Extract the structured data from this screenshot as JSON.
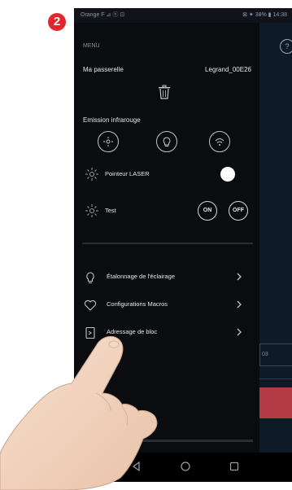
{
  "step_badge": "2",
  "status_bar": {
    "left": "Orange F  ⊿ ⓝ  ⊡",
    "right": "⊠ ⁕ 38% ▮ 14:38"
  },
  "background": {
    "help": "?",
    "input_value": "03"
  },
  "drawer": {
    "menu_label": "MENU",
    "gateway_label": "Ma passerelle",
    "gateway_value": "Legrand_00E26",
    "ir_label": "Emission infrarouge",
    "laser_label": "Pointeur LASER",
    "laser_on": true,
    "test_label": "Test",
    "test_on": "ON",
    "test_off": "OFF",
    "items": [
      {
        "label": "Étalonnage de l'éclairage",
        "icon": "bulb-icon"
      },
      {
        "label": "Configurations Macros",
        "icon": "heart-icon"
      },
      {
        "label": "Adressage de bloc",
        "icon": "block-address-icon"
      }
    ]
  },
  "colors": {
    "drawer_bg": "#0b0c0f",
    "badge": "#e3262c",
    "accent_red": "#b23b45",
    "skin": "#f2d4be"
  },
  "icons": [
    "trash-icon",
    "sun-icon",
    "bulb-icon",
    "wifi-icon",
    "laser-icon",
    "test-icon",
    "heart-icon",
    "block-address-icon",
    "chevron-right-icon",
    "back-icon",
    "home-icon",
    "recents-icon",
    "hand-pointer-icon"
  ]
}
